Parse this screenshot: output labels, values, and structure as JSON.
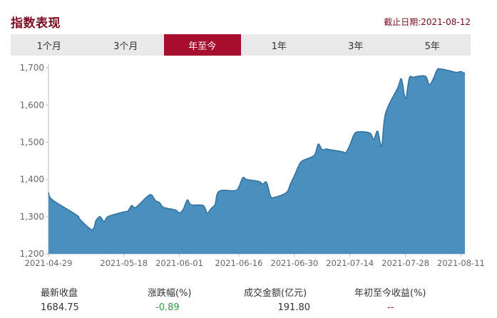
{
  "header": {
    "title": "指数表现",
    "as_of": "截止日期:2021-08-12"
  },
  "tabs": [
    {
      "label": "1个月",
      "active": false
    },
    {
      "label": "3个月",
      "active": false
    },
    {
      "label": "年至今",
      "active": true
    },
    {
      "label": "1年",
      "active": false
    },
    {
      "label": "3年",
      "active": false
    },
    {
      "label": "5年",
      "active": false
    }
  ],
  "stats": {
    "latest_close": {
      "label": "最新收盘",
      "value": "1684.75"
    },
    "change_pct": {
      "label": "涨跌幅(%)",
      "value": "-0.89"
    },
    "turnover": {
      "label": "成交金额(亿元)",
      "value": "191.80"
    },
    "ytd_return": {
      "label": "年初至今收益(%)",
      "value": "--"
    }
  },
  "colors": {
    "accent": "#a50e2d",
    "area_fill": "#4a90bf",
    "area_line": "#2f6f9e",
    "negative": "#2e9b3a",
    "ytd": "#a50e2d"
  },
  "chart_data": {
    "type": "area",
    "title": "",
    "xlabel": "",
    "ylabel": "",
    "ylim": [
      1200,
      1710
    ],
    "yticks": [
      1200,
      1300,
      1400,
      1500,
      1600,
      1700
    ],
    "ytick_labels": [
      "1,200",
      "1,300",
      "1,400",
      "1,500",
      "1,600",
      "1,700"
    ],
    "xticks": [
      "2021-04-29",
      "2021-05-18",
      "2021-06-01",
      "2021-06-16",
      "2021-06-30",
      "2021-07-14",
      "2021-07-28",
      "2021-08-11"
    ],
    "grid": false,
    "x": [
      "2021-04-29",
      "2021-04-30",
      "2021-05-06",
      "2021-05-07",
      "2021-05-10",
      "2021-05-11",
      "2021-05-12",
      "2021-05-13",
      "2021-05-14",
      "2021-05-17",
      "2021-05-18",
      "2021-05-19",
      "2021-05-20",
      "2021-05-21",
      "2021-05-24",
      "2021-05-25",
      "2021-05-26",
      "2021-05-27",
      "2021-05-28",
      "2021-05-31",
      "2021-06-01",
      "2021-06-02",
      "2021-06-03",
      "2021-06-04",
      "2021-06-07",
      "2021-06-08",
      "2021-06-09",
      "2021-06-10",
      "2021-06-11",
      "2021-06-15",
      "2021-06-16",
      "2021-06-17",
      "2021-06-18",
      "2021-06-21",
      "2021-06-22",
      "2021-06-23",
      "2021-06-24",
      "2021-06-25",
      "2021-06-28",
      "2021-06-29",
      "2021-06-30",
      "2021-07-01",
      "2021-07-02",
      "2021-07-05",
      "2021-07-06",
      "2021-07-07",
      "2021-07-08",
      "2021-07-09",
      "2021-07-12",
      "2021-07-13",
      "2021-07-14",
      "2021-07-15",
      "2021-07-16",
      "2021-07-19",
      "2021-07-20",
      "2021-07-21",
      "2021-07-22",
      "2021-07-23",
      "2021-07-26",
      "2021-07-27",
      "2021-07-28",
      "2021-07-29",
      "2021-07-30",
      "2021-08-02",
      "2021-08-03",
      "2021-08-04",
      "2021-08-05",
      "2021-08-06",
      "2021-08-09",
      "2021-08-10",
      "2021-08-11",
      "2021-08-12"
    ],
    "series": [
      {
        "values": [
          1365,
          1345,
          1305,
          1292,
          1265,
          1290,
          1300,
          1287,
          1300,
          1310,
          1313,
          1315,
          1330,
          1325,
          1355,
          1358,
          1343,
          1338,
          1325,
          1318,
          1310,
          1320,
          1345,
          1332,
          1330,
          1310,
          1322,
          1333,
          1368,
          1370,
          1380,
          1405,
          1400,
          1395,
          1388,
          1392,
          1355,
          1352,
          1365,
          1388,
          1410,
          1435,
          1450,
          1465,
          1495,
          1480,
          1482,
          1480,
          1475,
          1473,
          1493,
          1520,
          1528,
          1525,
          1508,
          1530,
          1490,
          1578,
          1645,
          1670,
          1618,
          1673,
          1675,
          1678,
          1655,
          1670,
          1695,
          1697,
          1690,
          1688,
          1690,
          1684.75
        ]
      }
    ]
  }
}
